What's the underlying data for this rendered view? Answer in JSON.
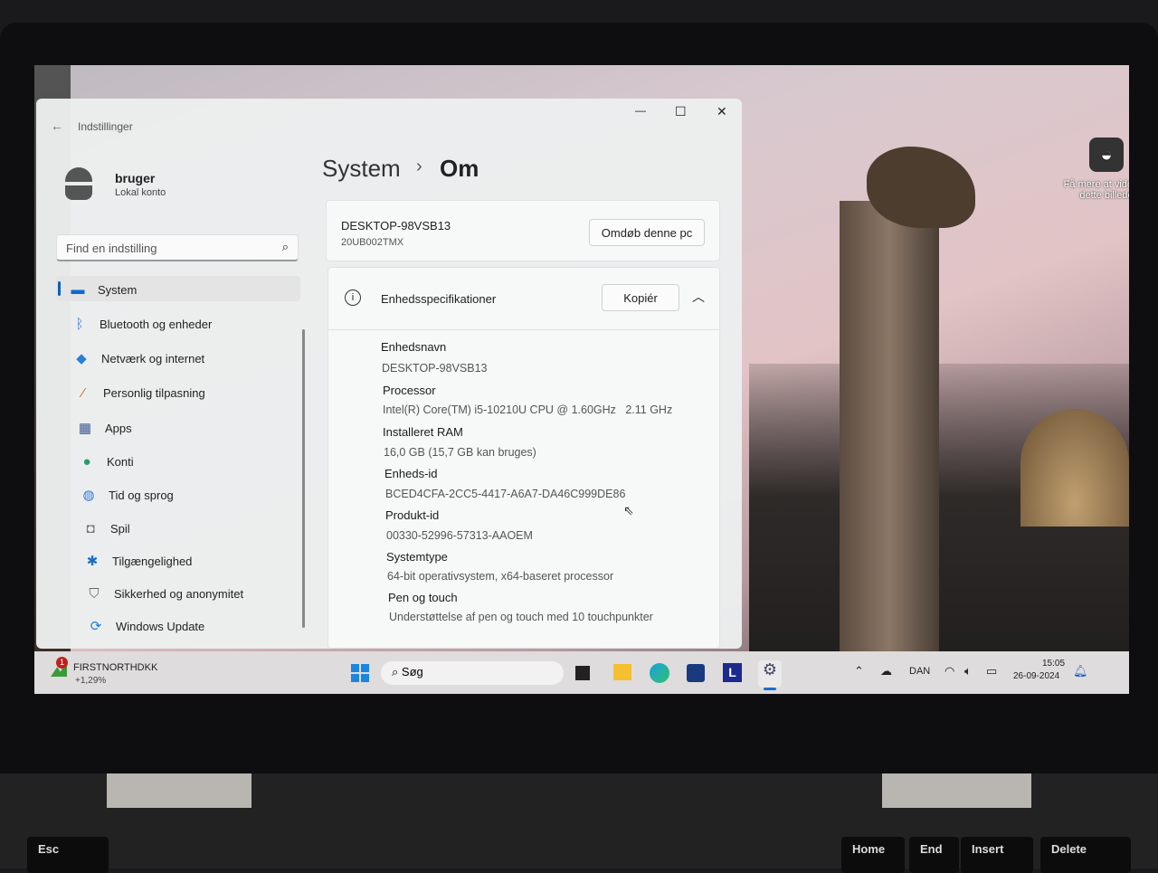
{
  "window": {
    "title": "Indstillinger",
    "minimize": "—",
    "maximize": "☐",
    "close": "✕"
  },
  "user": {
    "name": "bruger",
    "account": "Lokal konto"
  },
  "search": {
    "placeholder": "Find en indstilling"
  },
  "sidebar": {
    "items": [
      {
        "label": "System",
        "icon": "monitor-icon",
        "selected": true
      },
      {
        "label": "Bluetooth og enheder",
        "icon": "bluetooth-icon"
      },
      {
        "label": "Netværk og internet",
        "icon": "wifi-icon"
      },
      {
        "label": "Personlig tilpasning",
        "icon": "brush-icon"
      },
      {
        "label": "Apps",
        "icon": "apps-icon"
      },
      {
        "label": "Konti",
        "icon": "person-icon"
      },
      {
        "label": "Tid og sprog",
        "icon": "globe-clock-icon"
      },
      {
        "label": "Spil",
        "icon": "gamepad-icon"
      },
      {
        "label": "Tilgængelighed",
        "icon": "accessibility-icon"
      },
      {
        "label": "Sikkerhed og anonymitet",
        "icon": "shield-icon"
      },
      {
        "label": "Windows Update",
        "icon": "update-icon"
      }
    ]
  },
  "breadcrumb": {
    "parent": "System",
    "sep": "›",
    "current": "Om"
  },
  "device": {
    "name": "DESKTOP-98VSB13",
    "model": "20UB002TMX",
    "rename": "Omdøb denne pc"
  },
  "specs": {
    "title": "Enhedsspecifikationer",
    "copy": "Kopiér",
    "rows": [
      {
        "label": "Enhedsnavn",
        "value": "DESKTOP-98VSB13"
      },
      {
        "label": "Processor",
        "value": "Intel(R) Core(TM) i5-10210U CPU @ 1.60GHz   2.11 GHz"
      },
      {
        "label": "Installeret RAM",
        "value": "16,0 GB (15,7 GB kan bruges)"
      },
      {
        "label": "Enheds-id",
        "value": "BCED4CFA-2CC5-4417-A6A7-DA46C999DE86"
      },
      {
        "label": "Produkt-id",
        "value": "00330-52996-57313-AAOEM"
      },
      {
        "label": "Systemtype",
        "value": "64-bit operativsystem, x64-baseret processor"
      },
      {
        "label": "Pen og touch",
        "value": "Understøttelse af pen og touch med 10 touchpunkter"
      }
    ]
  },
  "wallpaper": {
    "learn_more": "Få mere at vide om dette billede"
  },
  "taskbar": {
    "stock_name": "FIRSTNORTHDKK",
    "stock_change": "+1,29%",
    "stock_badge": "1",
    "search": "Søg",
    "lang": "DAN",
    "time": "15:05",
    "date": "26-09-2024"
  },
  "keyboard": {
    "keys": [
      "Esc",
      "Home",
      "End",
      "Insert",
      "Delete"
    ]
  }
}
